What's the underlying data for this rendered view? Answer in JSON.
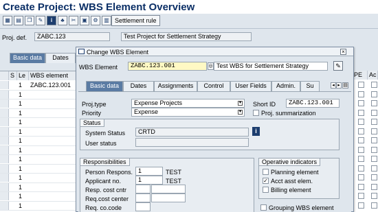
{
  "page": {
    "title": "Create Project: WBS Element Overview"
  },
  "toolbar": {
    "icons": [
      "overview-icon",
      "detail-icon",
      "copy-icon",
      "edit-icon",
      "info-icon",
      "hierarchy-icon",
      "cut-icon",
      "paste-icon",
      "settings-icon",
      "layout-icon"
    ],
    "settlement_rule": "Settlement rule"
  },
  "header": {
    "proj_def_label": "Proj. def.",
    "proj_def_value": "ZABC.123",
    "proj_def_desc": "Test Project for Settlement Strategy"
  },
  "main_tabs": [
    "Basic data",
    "Dates"
  ],
  "table": {
    "col_s": "S",
    "col_le": "Le",
    "col_wbs": "WBS element",
    "rows": [
      {
        "level": "1",
        "wbs": "ZABC.123.001"
      },
      {
        "level": "1",
        "wbs": ""
      },
      {
        "level": "1",
        "wbs": ""
      },
      {
        "level": "1",
        "wbs": ""
      },
      {
        "level": "1",
        "wbs": ""
      },
      {
        "level": "1",
        "wbs": ""
      },
      {
        "level": "1",
        "wbs": ""
      },
      {
        "level": "1",
        "wbs": ""
      },
      {
        "level": "1",
        "wbs": ""
      },
      {
        "level": "1",
        "wbs": ""
      },
      {
        "level": "1",
        "wbs": ""
      },
      {
        "level": "1",
        "wbs": ""
      },
      {
        "level": "1",
        "wbs": ""
      },
      {
        "level": "1",
        "wbs": ""
      }
    ],
    "right_col_pe": "PE",
    "right_col_ac": "Ac"
  },
  "dialog": {
    "title": "Change WBS Element",
    "wbs_label": "WBS Element",
    "wbs_value": "ZABC.123.001",
    "wbs_desc": "Test WBS for Settlement Strategy",
    "tabs": [
      "Basic data",
      "Dates",
      "Assignments",
      "Control",
      "User Fields",
      "Admin.",
      "Su"
    ],
    "proj_type_label": "Proj.type",
    "proj_type_value": "Expense Projects",
    "priority_label": "Priority",
    "priority_value": "Expense",
    "short_id_label": "Short ID",
    "short_id_value": "ZABC.123.001",
    "proj_summ_label": "Proj. summarization",
    "status": {
      "group_label": "Status",
      "system_status_label": "System Status",
      "system_status_value": "CRTD",
      "user_status_label": "User status",
      "user_status_value": ""
    },
    "responsibilities": {
      "group_label": "Responsibilities",
      "person_label": "Person Respons.",
      "person_value": "1",
      "person_name": "TEST",
      "applicant_label": "Applicant no.",
      "applicant_value": "1",
      "applicant_name": "TEST",
      "resp_cc_label": "Resp. cost cntr",
      "req_cc_label": "Req.cost center",
      "req_cocode_label": "Req. co.code"
    },
    "operative": {
      "group_label": "Operative indicators",
      "planning_label": "Planning element",
      "planning_checked": false,
      "acct_label": "Acct asst elem.",
      "acct_checked": true,
      "billing_label": "Billing element",
      "billing_checked": false,
      "grouping_label": "Grouping WBS element"
    }
  }
}
